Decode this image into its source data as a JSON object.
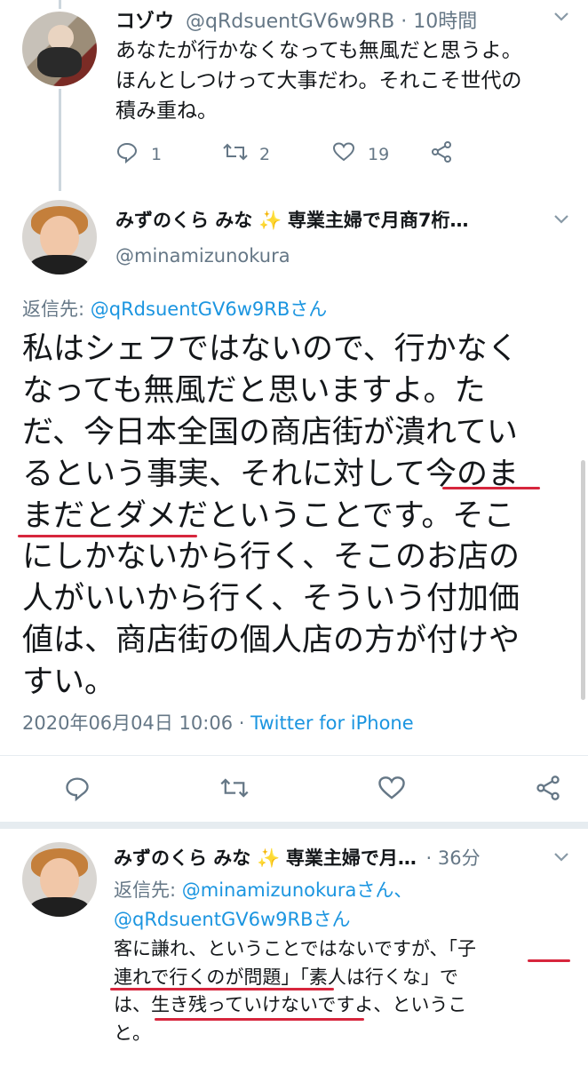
{
  "tweet1": {
    "display_name": "コゾウ",
    "handle": "@qRdsuentGV6w9RB",
    "time": "10時間",
    "text_lines": [
      "あなたが行かなくなっても無風だと思うよ。",
      "ほんとしつけって大事だわ。それこそ世代の",
      "積み重ね。"
    ],
    "reply_count": "1",
    "retweet_count": "2",
    "like_count": "19"
  },
  "tweet2": {
    "display_name": "みずのくら みな",
    "name_suffix": "専業主婦で月商7桁…",
    "sparkle": "✨",
    "handle": "@minamizunokura",
    "reply_to_label": "返信先:",
    "reply_to_user": "@qRdsuentGV6w9RBさん",
    "text_lines": [
      "私はシェフではないので、行かなく",
      "なっても無風だと思いますよ。た",
      "だ、今日本全国の商店街が潰れてい",
      "るという事実、それに対して今のま",
      "まだとダメだということです。そこ",
      "にしかないから行く、そこのお店の",
      "人がいいから行く、そういう付加価",
      "値は、商店街の個人店の方が付けや",
      "すい。"
    ],
    "timestamp": "2020年06月04日 10:06",
    "dot": "·",
    "source": "Twitter for iPhone"
  },
  "tweet3": {
    "display_name": "みずのくら みな",
    "name_suffix": "専業主婦で月…",
    "sparkle": "✨",
    "time": "· 36分",
    "reply_to_label": "返信先:",
    "reply_to_user1": "@minamizunokuraさん、",
    "reply_to_user2": "@qRdsuentGV6w9RBさん",
    "text_lines": [
      "客に謙れ、ということではないですが、「子",
      "連れで行くのが問題」「素人は行くな」で",
      "は、生き残っていけないですよ、というこ",
      "と。"
    ]
  },
  "colors": {
    "link": "#1b95e0",
    "muted": "#657786",
    "underline_mark": "#d7263d"
  }
}
